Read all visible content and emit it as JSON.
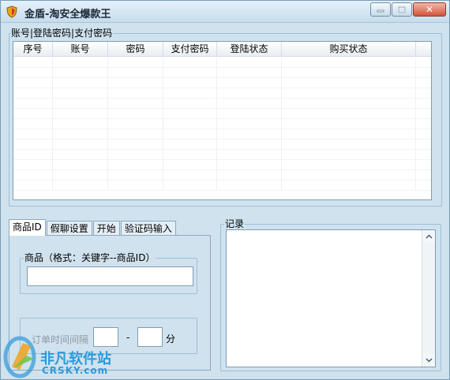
{
  "window": {
    "title": "金盾-淘安全爆款王",
    "minimize_label": "",
    "maximize_label": "",
    "close_label": "✕"
  },
  "accounts_group": {
    "label": "账号|登陆密码|支付密码",
    "columns": [
      "序号",
      "账号",
      "密码",
      "支付密码",
      "登陆状态",
      "购买状态"
    ]
  },
  "tabs": [
    "商品ID",
    "假聊设置",
    "开始",
    "验证码输入"
  ],
  "product_group": {
    "label": "商品（格式：关键字--商品ID）",
    "value": ""
  },
  "interval": {
    "label": "订单时间间隔",
    "from_value": "",
    "dash": "-",
    "to_value": "",
    "unit": "分"
  },
  "record_group": {
    "label": "记录",
    "value": ""
  },
  "watermark": {
    "cn": "非凡软件站",
    "en": "CRSKY.com"
  },
  "colors": {
    "window_bg": "#cfe2ee",
    "watermark": "#2d9ad8"
  }
}
